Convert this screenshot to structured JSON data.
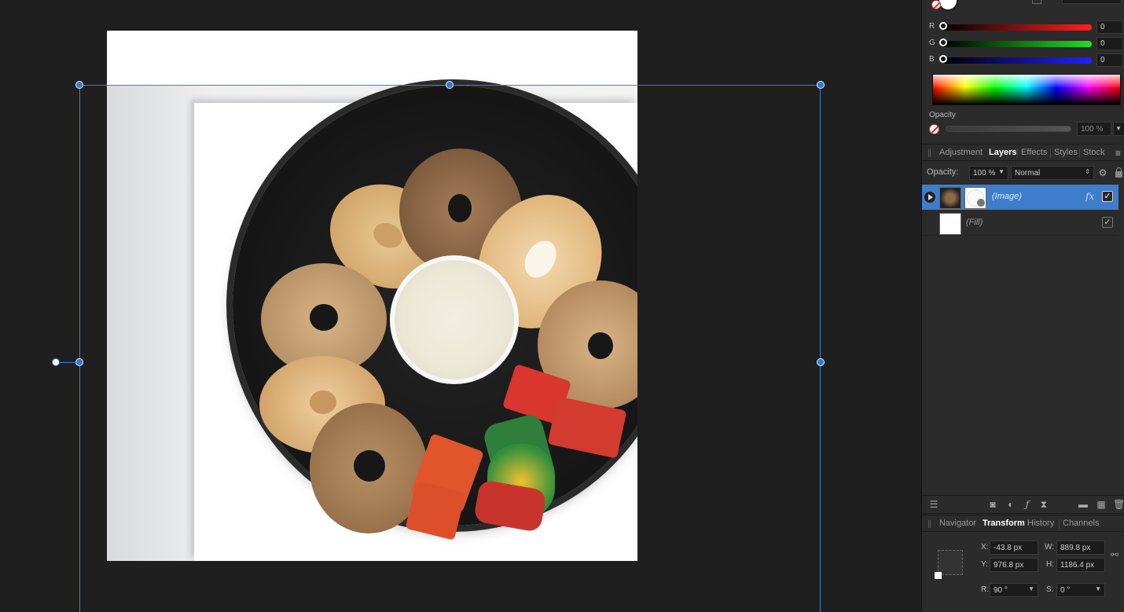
{
  "color": {
    "channels": [
      {
        "label": "R",
        "value": "0",
        "gradient": "linear-gradient(90deg,#000,#ff2020)"
      },
      {
        "label": "G",
        "value": "0",
        "gradient": "linear-gradient(90deg,#000,#22e022)"
      },
      {
        "label": "B",
        "value": "0",
        "gradient": "linear-gradient(90deg,#000,#2020ff)"
      }
    ],
    "opacity_label": "Opacity",
    "opacity_value": "100 %"
  },
  "panel_tabs": {
    "items": [
      "Adjustment",
      "Layers",
      "Effects",
      "Styles",
      "Stock"
    ],
    "active": "Layers"
  },
  "layers": {
    "opacity_label": "Opacity:",
    "opacity_value": "100 %",
    "blend_mode": "Normal",
    "items": [
      {
        "name": "(Image)",
        "selected": true,
        "fx_label": "fx",
        "visible": true
      },
      {
        "name": "(Fill)",
        "selected": false,
        "visible": true
      }
    ]
  },
  "bottom_tabs": {
    "items": [
      "Navigator",
      "Transform",
      "History",
      "Channels"
    ],
    "active": "Transform"
  },
  "transform": {
    "x_label": "X:",
    "x_value": "-43.8 px",
    "y_label": "Y:",
    "y_value": "976.8 px",
    "w_label": "W:",
    "w_value": "889.8 px",
    "h_label": "H:",
    "h_value": "1186.4 px",
    "r_label": "R:",
    "r_value": "90 °",
    "s_label": "S:",
    "s_value": "0 °"
  },
  "colors": {
    "accent": "#3e7dcc",
    "selection_handle": "#2e7ad6",
    "panel_bg": "#2b2b2b",
    "workspace_bg": "#1f1f1f"
  }
}
